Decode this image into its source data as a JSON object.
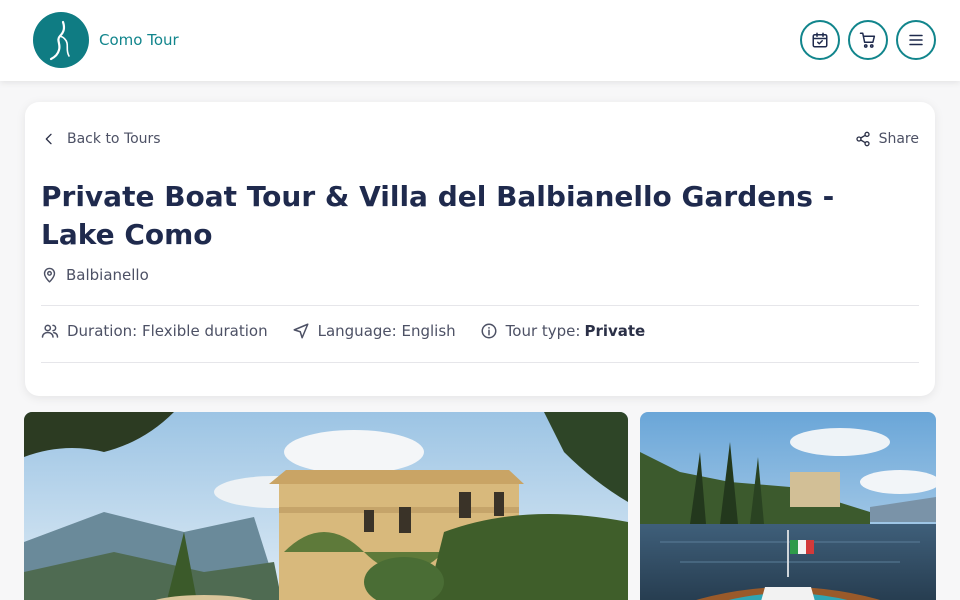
{
  "header": {
    "logo_text": "Como Tour",
    "icons": [
      "calendar-check-icon",
      "cart-icon",
      "menu-icon"
    ]
  },
  "colors": {
    "brand": "#11858c",
    "title": "#1f2a4d",
    "text": "#4d5165"
  },
  "tour": {
    "back_label": "Back to Tours",
    "share_label": "Share",
    "title": "Private Boat Tour & Villa del Balbianello Gardens - Lake Como",
    "location": "Balbianello",
    "duration_label": "Duration:",
    "duration_value": "Flexible duration",
    "language_label": "Language:",
    "language_value": "English",
    "tour_type_label": "Tour type:",
    "tour_type_value": "Private"
  },
  "gallery": {
    "images": [
      "villa-photo",
      "boat-photo"
    ]
  }
}
